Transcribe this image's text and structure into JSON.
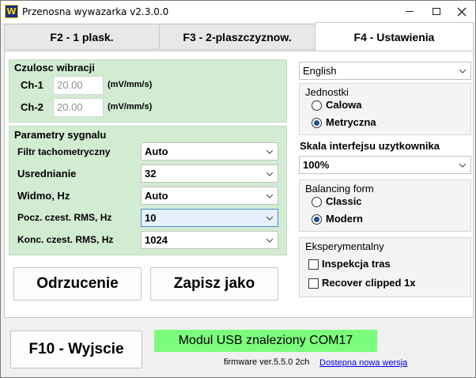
{
  "window": {
    "title": "Przenosna wywazarka v2.3.0.0",
    "icon": "app-logo-icon",
    "icon_letter": "W"
  },
  "tabs": [
    {
      "label": "F2 - 1 plask.",
      "active": false
    },
    {
      "label": "F3 - 2-plaszczyznow.",
      "active": false
    },
    {
      "label": "F4 - Ustawienia",
      "active": true
    }
  ],
  "vibration": {
    "title": "Czulosc wibracji",
    "ch1": {
      "label": "Ch-1",
      "value": "20.00",
      "unit": "(mV/mm/s)"
    },
    "ch2": {
      "label": "Ch-2",
      "value": "20.00",
      "unit": "(mV/mm/s)"
    }
  },
  "signal": {
    "title": "Parametry sygnalu",
    "rows": [
      {
        "label": "Filtr tachometryczny",
        "value": "Auto"
      },
      {
        "label": "Usrednianie",
        "value": "32"
      },
      {
        "label": "Widmo, Hz",
        "value": "Auto"
      },
      {
        "label": "Pocz. czest. RMS, Hz",
        "value": "10"
      },
      {
        "label": "Konc. czest. RMS, Hz",
        "value": "1024"
      }
    ]
  },
  "buttons": {
    "discard": "Odrzucenie",
    "save_as": "Zapisz jako",
    "exit": "F10 - Wyjscie"
  },
  "language": {
    "value": "English"
  },
  "units": {
    "title": "Jednostki",
    "options": [
      "Calowa",
      "Metryczna"
    ],
    "selected": "Metryczna"
  },
  "ui_scale": {
    "label": "Skala interfejsu uzytkownika",
    "value": "100%"
  },
  "balancing": {
    "title": "Balancing form",
    "options": [
      "Classic",
      "Modern"
    ],
    "selected": "Modern"
  },
  "experimental": {
    "title": "Eksperymentalny",
    "options": [
      {
        "label": "Inspekcja tras",
        "checked": false
      },
      {
        "label": "Recover clipped 1x",
        "checked": false
      }
    ]
  },
  "status": {
    "text": "Modul USB znaleziony COM17",
    "color": "#7cfc7c"
  },
  "footer": {
    "firmware": "firmware ver.5.5.0 2ch",
    "update_link": "Dostepna nowa wersja"
  }
}
